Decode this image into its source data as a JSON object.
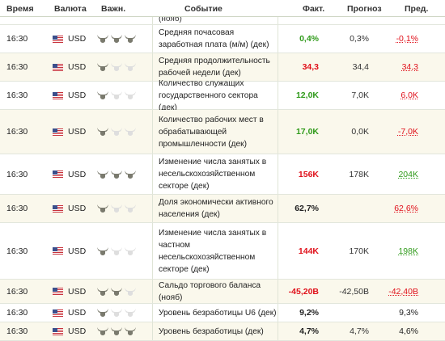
{
  "header": {
    "time": "Время",
    "currency": "Валюта",
    "importance": "Важн.",
    "event": "Событие",
    "actual": "Факт.",
    "forecast": "Прогноз",
    "previous": "Пред."
  },
  "colors": {
    "green": "#2f9a1a",
    "red": "#e0101a",
    "dark": "#222222"
  },
  "cut_row_event": "(нояб)",
  "rows": [
    {
      "time": "16:30",
      "currency": "USD",
      "bulls": 3,
      "event": "Средняя почасовая заработная плата (м/м) (дек)",
      "actual": "0,4%",
      "actual_color": "green",
      "forecast": "0,3%",
      "previous": "-0,1%",
      "previous_color": "red"
    },
    {
      "time": "16:30",
      "currency": "USD",
      "bulls": 1,
      "event": "Средняя продолжительность рабочей недели (дек)",
      "actual": "34,3",
      "actual_color": "red",
      "forecast": "34,4",
      "previous": "34,3",
      "previous_color": "red"
    },
    {
      "time": "16:30",
      "currency": "USD",
      "bulls": 1,
      "event": "Количество служащих государственного сектора (дек)",
      "actual": "12,0K",
      "actual_color": "green",
      "forecast": "7,0K",
      "previous": "6,0K",
      "previous_color": "red"
    },
    {
      "time": "16:30",
      "currency": "USD",
      "bulls": 1,
      "event": "Количество рабочих мест в обрабатывающей промышленности (дек)",
      "actual": "17,0K",
      "actual_color": "green",
      "forecast": "0,0K",
      "previous": "-7,0K",
      "previous_color": "red"
    },
    {
      "time": "16:30",
      "currency": "USD",
      "bulls": 3,
      "event": "Изменение числа занятых в несельскохозяйственном секторе (дек)",
      "actual": "156K",
      "actual_color": "red",
      "forecast": "178K",
      "previous": "204K",
      "previous_color": "green"
    },
    {
      "time": "16:30",
      "currency": "USD",
      "bulls": 1,
      "event": "Доля экономически активного населения (дек)",
      "actual": "62,7%",
      "actual_color": "dark",
      "forecast": "",
      "previous": "62,6%",
      "previous_color": "red"
    },
    {
      "time": "16:30",
      "currency": "USD",
      "bulls": 1,
      "event": "Изменение числа занятых в частном несельскохозяйственном секторе (дек)",
      "actual": "144K",
      "actual_color": "red",
      "forecast": "170K",
      "previous": "198K",
      "previous_color": "green"
    },
    {
      "time": "16:30",
      "currency": "USD",
      "bulls": 2,
      "event": "Сальдо торгового баланса (нояб)",
      "actual": "-45,20B",
      "actual_color": "red",
      "forecast": "-42,50B",
      "previous": "-42,40B",
      "previous_color": "red"
    },
    {
      "time": "16:30",
      "currency": "USD",
      "bulls": 1,
      "event": "Уровень безработицы U6 (дек)",
      "actual": "9,2%",
      "actual_color": "dark",
      "forecast": "",
      "previous": "9,3%",
      "previous_color": "dark"
    },
    {
      "time": "16:30",
      "currency": "USD",
      "bulls": 3,
      "event": "Уровень безработицы (дек)",
      "actual": "4,7%",
      "actual_color": "dark",
      "forecast": "4,7%",
      "previous": "4,6%",
      "previous_color": "dark"
    }
  ]
}
